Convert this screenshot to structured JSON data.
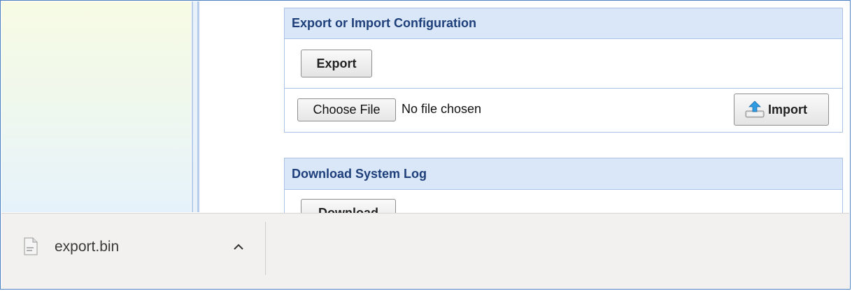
{
  "export_import": {
    "header": "Export or Import Configuration",
    "export_label": "Export",
    "choose_file_label": "Choose File",
    "file_status": "No file chosen",
    "import_label": "Import"
  },
  "system_log": {
    "header": "Download System Log",
    "download_label": "Download"
  },
  "download_shelf": {
    "item_name": "export.bin",
    "item_icon": "file-icon",
    "expand_icon": "chevron-up-icon"
  },
  "colors": {
    "header_bg": "#d9e7f8",
    "header_text": "#1e3f7a",
    "border_accent": "#a9c2e6"
  }
}
